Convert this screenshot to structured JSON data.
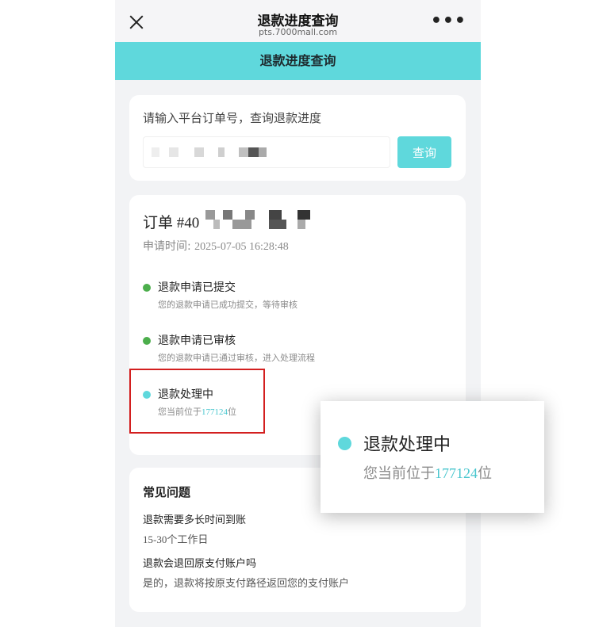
{
  "titlebar": {
    "title": "退款进度查询",
    "url": "pts.7000mall.com",
    "more_label": "•••"
  },
  "banner": {
    "title": "退款进度查询"
  },
  "search": {
    "hint": "请输入平台订单号，查询退款进度",
    "button_label": "查询"
  },
  "order": {
    "prefix": "订单 #40",
    "time_label": "申请时间:",
    "time_value": "2025-07-05 16:28:48",
    "steps": [
      {
        "title": "退款申请已提交",
        "desc": "您的退款申请已成功提交，等待审核",
        "status_color": "#4cae4c"
      },
      {
        "title": "退款申请已审核",
        "desc": "您的退款申请已通过审核，进入处理流程",
        "status_color": "#4cae4c"
      },
      {
        "title": "退款处理中",
        "desc_before": "您当前位于",
        "position": "177124",
        "desc_after": "位",
        "status_color": "#5fd8dc"
      }
    ]
  },
  "faq": {
    "title": "常见问题",
    "items": [
      {
        "q": "退款需要多长时间到账",
        "a": "15-30个工作日"
      },
      {
        "q": "退款会退回原支付账户吗",
        "a": "是的，退款将按原支付路径返回您的支付账户"
      }
    ]
  },
  "colors": {
    "accent": "#5fd8dc",
    "success": "#4cae4c",
    "highlight": "#d31f1f"
  }
}
